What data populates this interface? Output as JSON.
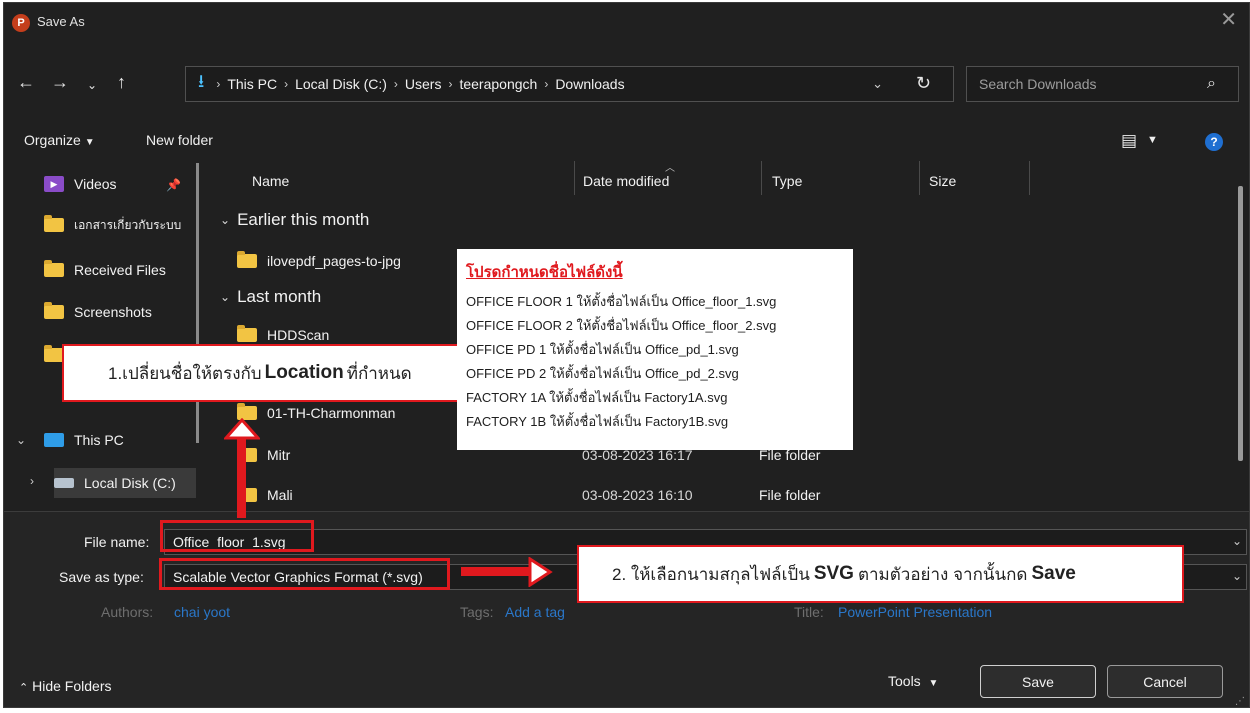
{
  "window": {
    "title": "Save As",
    "app_icon": "P"
  },
  "nav": {
    "breadcrumb": [
      "This PC",
      "Local Disk (C:)",
      "Users",
      "teerapongch",
      "Downloads"
    ],
    "search_placeholder": "Search Downloads"
  },
  "toolbar": {
    "organize": "Organize",
    "new_folder": "New folder"
  },
  "sidebar": {
    "items": [
      {
        "label": "Videos",
        "icon": "video-folder-icon"
      },
      {
        "label": "เอกสารเกี่ยวกับระบบ",
        "icon": "folder-icon"
      },
      {
        "label": "Received Files",
        "icon": "folder-icon"
      },
      {
        "label": "Screenshots",
        "icon": "folder-icon"
      }
    ],
    "this_pc": "This PC",
    "local_disk": "Local Disk (C:)"
  },
  "columns": {
    "name": "Name",
    "date": "Date modified",
    "type": "Type",
    "size": "Size"
  },
  "groups": {
    "earlier": "Earlier this month",
    "last_month": "Last month"
  },
  "files": [
    {
      "name": "ilovepdf_pages-to-jpg",
      "date": "",
      "type": ""
    },
    {
      "name": "HDDScan",
      "date": "",
      "type": ""
    },
    {
      "name": "01-TH-Charmonman",
      "date": "",
      "type": ""
    },
    {
      "name": "Mitr",
      "date": "03-08-2023 16:17",
      "type": "File folder"
    },
    {
      "name": "Mali",
      "date": "03-08-2023 16:10",
      "type": "File folder"
    }
  ],
  "bottom": {
    "file_name_label": "File name:",
    "file_name_value": "Office_floor_1.svg",
    "save_type_label": "Save as type:",
    "save_type_value": "Scalable Vector Graphics Format (*.svg)",
    "authors_label": "Authors:",
    "authors_value": "chai yoot",
    "tags_label": "Tags:",
    "tags_value": "Add a tag",
    "title_label": "Title:",
    "title_value": "PowerPoint Presentation",
    "hide_folders": "Hide Folders",
    "tools": "Tools",
    "save": "Save",
    "cancel": "Cancel"
  },
  "annotations": {
    "callout1_prefix": "1.เปลี่ยนชื่อให้ตรงกับ ",
    "callout1_bold": "Location",
    "callout1_suffix": " ที่กำหนด",
    "callout2_prefix": "2. ให้เลือกนามสกุลไฟล์เป็น ",
    "callout2_bold1": "SVG",
    "callout2_mid": " ตามตัวอย่าง จากนั้นกด ",
    "callout2_bold2": "Save",
    "note_title": "โปรดกำหนดชื่อไฟล์ดังนี้",
    "note_lines": [
      "OFFICE FLOOR 1 ให้ตั้งชื่อไฟล์เป็น Office_floor_1.svg",
      "OFFICE FLOOR 2 ให้ตั้งชื่อไฟล์เป็น Office_floor_2.svg",
      "OFFICE PD 1 ให้ตั้งชื่อไฟล์เป็น Office_pd_1.svg",
      "OFFICE PD 2 ให้ตั้งชื่อไฟล์เป็น Office_pd_2.svg",
      "FACTORY 1A ให้ตั้งชื่อไฟล์เป็น Factory1A.svg",
      "FACTORY 1B ให้ตั้งชื่อไฟล์เป็น Factory1B.svg"
    ]
  },
  "colors": {
    "accent_red": "#e0191e",
    "link_blue": "#2a77c9",
    "folder": "#f2c443",
    "background": "#202020"
  }
}
